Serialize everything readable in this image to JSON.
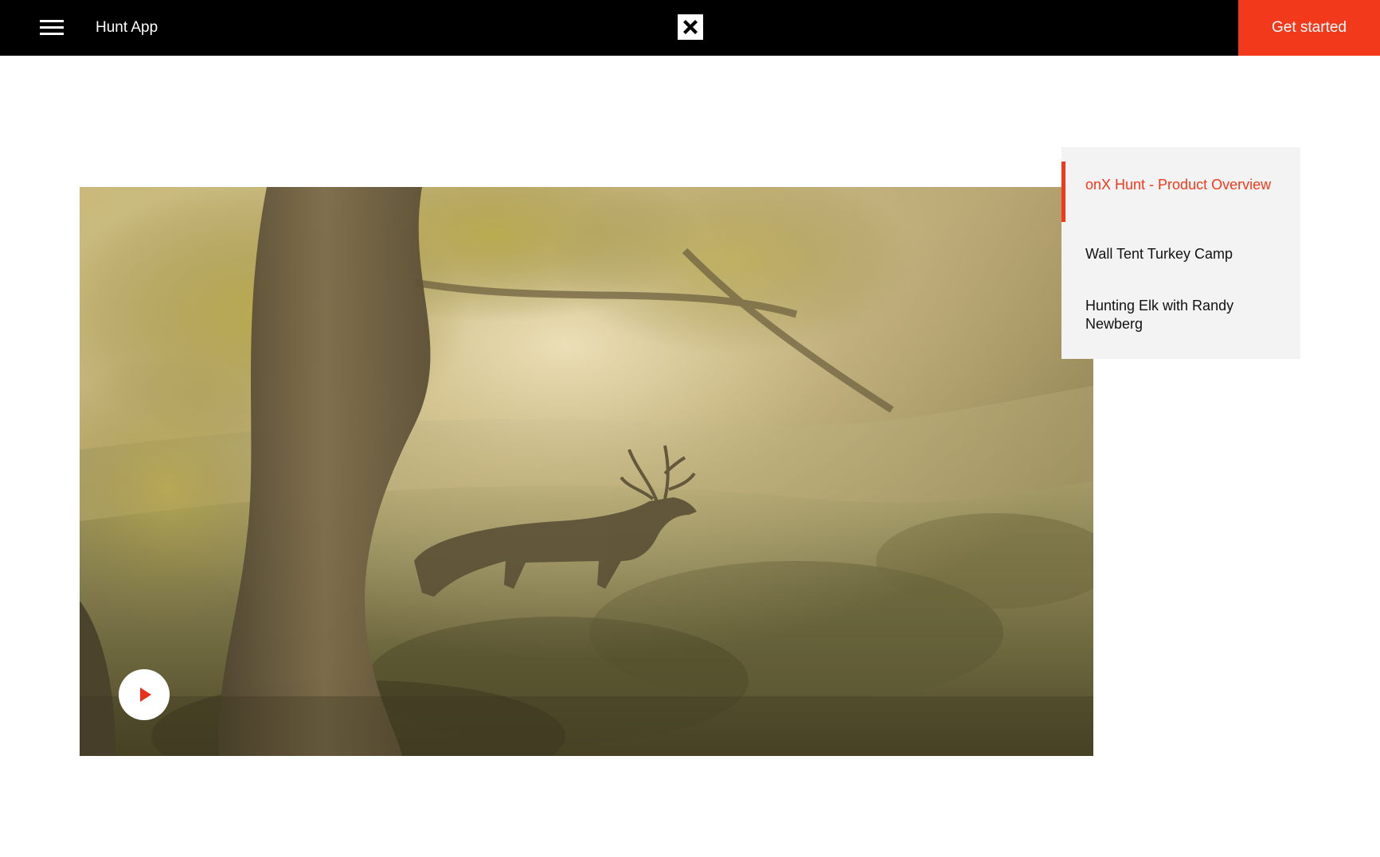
{
  "header": {
    "menu_icon": "hamburger-menu-icon",
    "app_title": "Hunt App",
    "logo_icon": "x-logo-icon",
    "cta_label": "Get started",
    "cta_color": "#f2391b",
    "background_color": "#000000"
  },
  "video": {
    "play_icon": "play-icon",
    "play_color": "#e8321c"
  },
  "playlist": {
    "active_color": "#f2391b",
    "items": [
      {
        "label": "onX Hunt - Product Overview",
        "active": true
      },
      {
        "label": "Wall Tent Turkey Camp",
        "active": false
      },
      {
        "label": "Hunting Elk with Randy Newberg",
        "active": false
      }
    ]
  }
}
